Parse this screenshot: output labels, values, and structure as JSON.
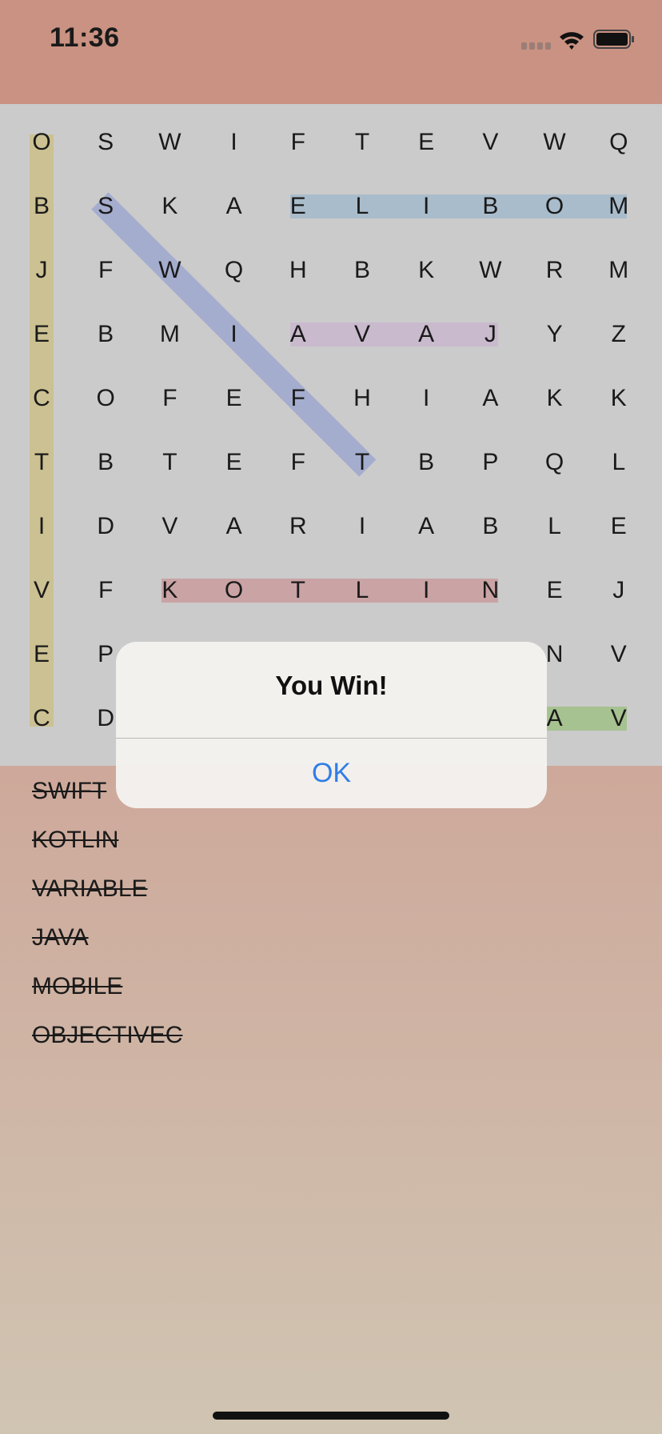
{
  "status_bar": {
    "time": "11:36"
  },
  "grid": {
    "rows": [
      [
        "O",
        "S",
        "W",
        "I",
        "F",
        "T",
        "E",
        "V",
        "W",
        "Q"
      ],
      [
        "B",
        "S",
        "K",
        "A",
        "E",
        "L",
        "I",
        "B",
        "O",
        "M"
      ],
      [
        "J",
        "F",
        "W",
        "Q",
        "H",
        "B",
        "K",
        "W",
        "R",
        "M"
      ],
      [
        "E",
        "B",
        "M",
        "I",
        "A",
        "V",
        "A",
        "J",
        "Y",
        "Z"
      ],
      [
        "C",
        "O",
        "F",
        "E",
        "F",
        "H",
        "I",
        "A",
        "K",
        "K"
      ],
      [
        "T",
        "B",
        "T",
        "E",
        "F",
        "T",
        "B",
        "P",
        "Q",
        "L"
      ],
      [
        "I",
        "D",
        "V",
        "A",
        "R",
        "I",
        "A",
        "B",
        "L",
        "E"
      ],
      [
        "V",
        "F",
        "K",
        "O",
        "T",
        "L",
        "I",
        "N",
        "E",
        "J"
      ],
      [
        "E",
        "P",
        "",
        "",
        "",
        "",
        "",
        "",
        "N",
        "V"
      ],
      [
        "C",
        "D",
        "",
        "",
        "",
        "",
        "",
        "",
        "A",
        "V"
      ]
    ],
    "found_highlights": [
      {
        "word": "OBJECTIVEC",
        "color": "#cbc08e"
      },
      {
        "word": "MOBILE",
        "color": "#a7bbca"
      },
      {
        "word": "SWIFT",
        "color": "#a2abce"
      },
      {
        "word": "JAVA",
        "color": "#c9b8ce"
      },
      {
        "word": "KOTLIN",
        "color": "#c9a0a2"
      },
      {
        "word": "VARIABLE",
        "color": "#a3c18c"
      }
    ]
  },
  "word_list": [
    "SWIFT",
    "KOTLIN",
    "VARIABLE",
    "JAVA",
    "MOBILE",
    "OBJECTIVEC"
  ],
  "alert": {
    "title": "You Win!",
    "ok_label": "OK"
  }
}
